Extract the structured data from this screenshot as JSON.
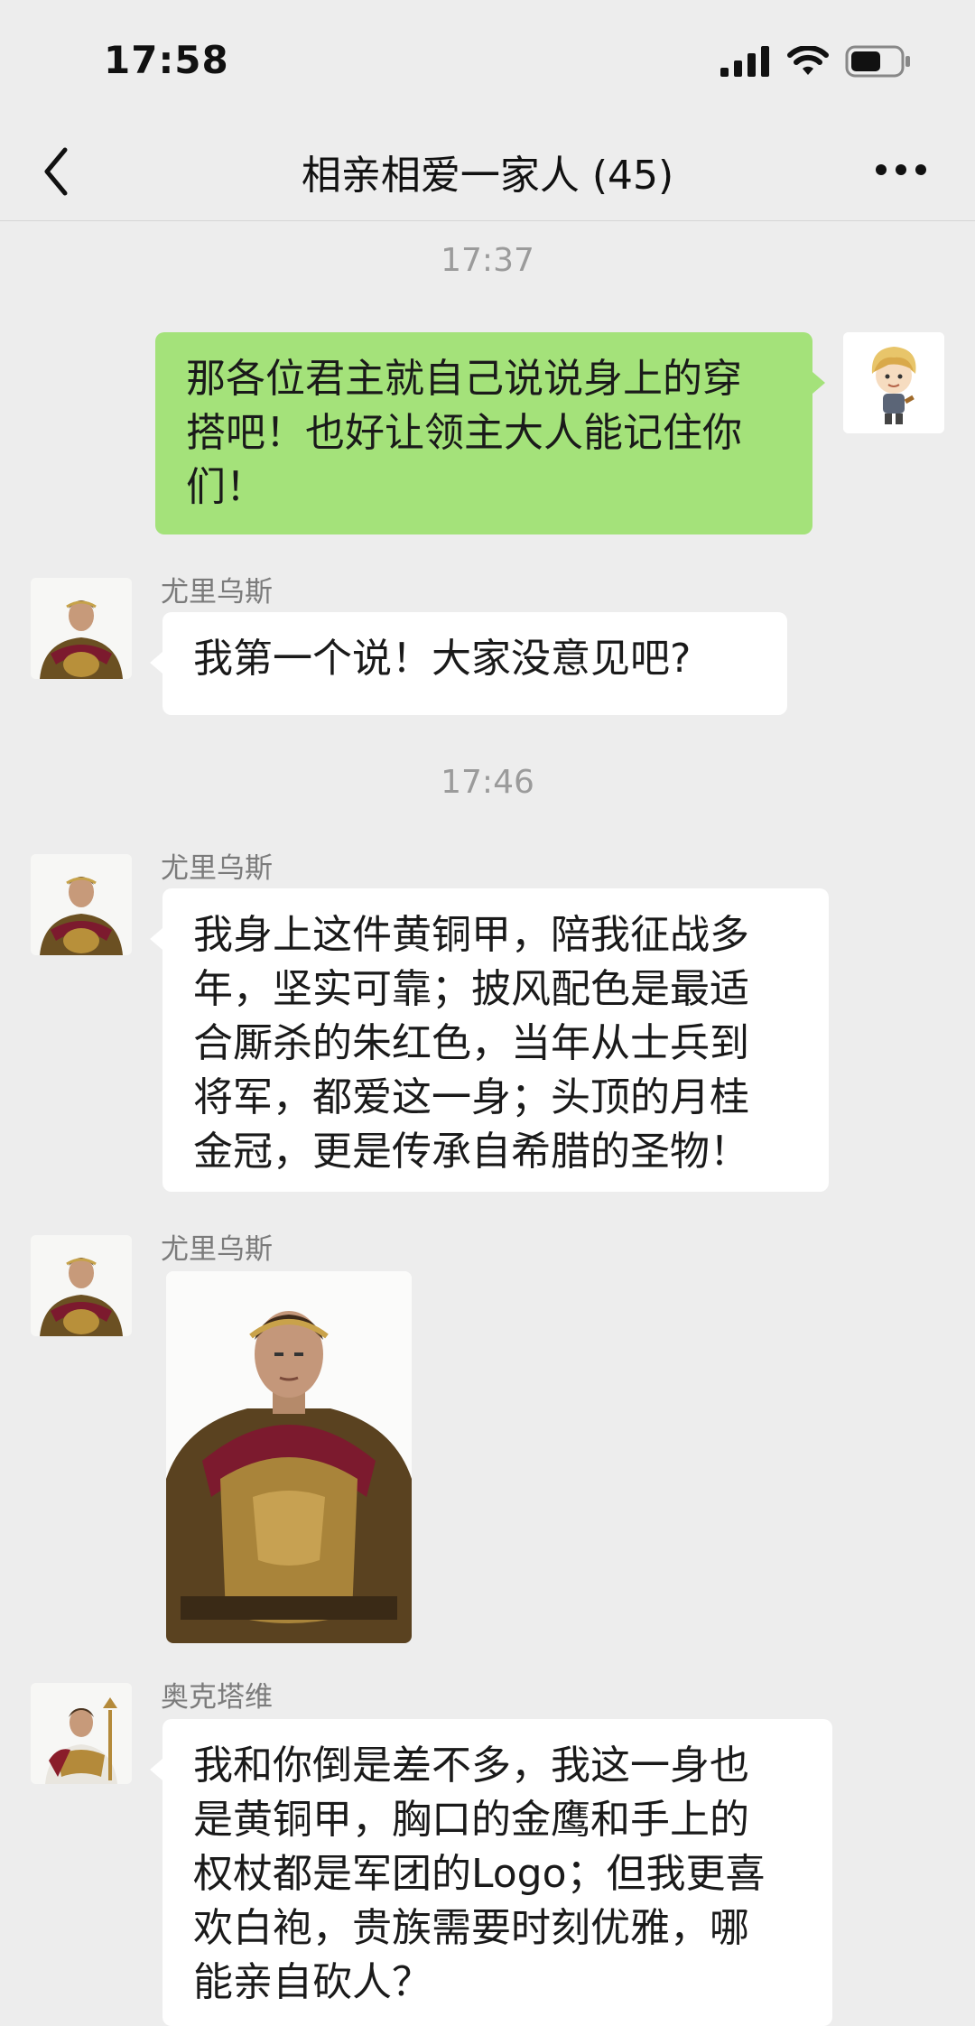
{
  "status": {
    "time": "17:58"
  },
  "header": {
    "title": "相亲相爱一家人 (45)"
  },
  "messages": {
    "ts1": "17:37",
    "m1": "那各位君主就自己说说身上的穿\n搭吧！也好让领主大人能记住你\n们！",
    "s2": "尤里乌斯",
    "m2": "我第一个说！大家没意见吧?",
    "ts2": "17:46",
    "s3": "尤里乌斯",
    "m3": "我身上这件黄铜甲，陪我征战多\n年，坚实可靠；披风配色是最适\n合厮杀的朱红色，当年从士兵到\n将军，都爱这一身；头顶的月桂\n金冠，更是传承自希腊的圣物！",
    "s4": "尤里乌斯",
    "s5": "奥克塔维",
    "m5": "我和你倒是差不多，我这一身也\n是黄铜甲，胸口的金鹰和手上的\n权杖都是军团的Logo；但我更喜\n欢白袍，贵族需要时刻优雅，哪\n能亲自砍人？"
  },
  "colors": {
    "out_bubble": "#a4e27a",
    "in_bubble": "#ffffff",
    "background": "#ededed"
  },
  "icons": [
    "back-chevron-icon",
    "more-icon",
    "signal-icon",
    "wifi-icon",
    "battery-icon"
  ]
}
